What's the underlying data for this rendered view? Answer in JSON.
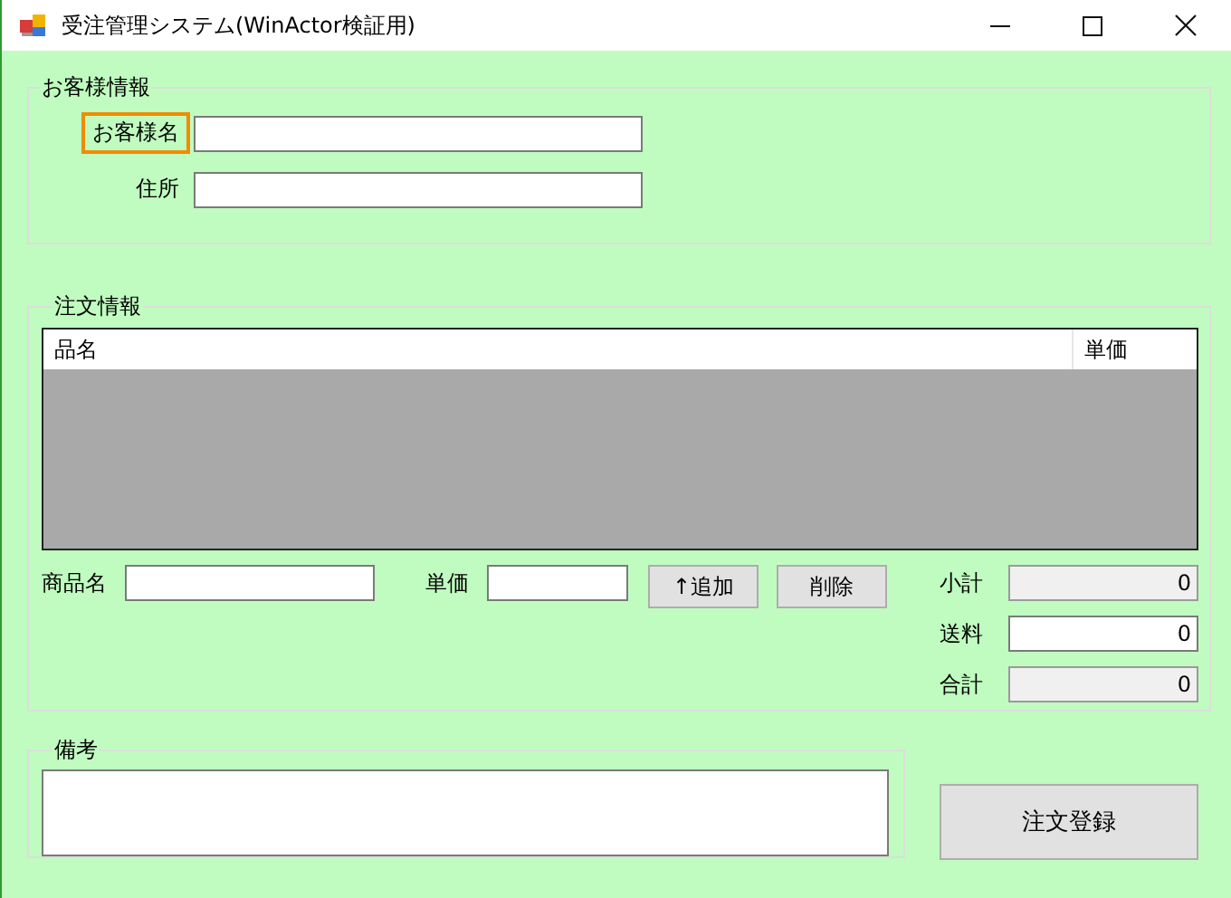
{
  "window": {
    "title": "受注管理システム(WinActor検証用)"
  },
  "customer_group": {
    "legend": "お客様情報",
    "fields": [
      {
        "label": "お客様名",
        "focused": true
      },
      {
        "label": "住所",
        "focused": false
      }
    ]
  },
  "order_group": {
    "legend": "注文情報",
    "list": {
      "columns": [
        "品名",
        "単価"
      ]
    },
    "entry": {
      "fields": [
        {
          "label": "商品名"
        },
        {
          "label": "単価"
        }
      ],
      "buttons": [
        "↑追加",
        "削除"
      ]
    },
    "totals": [
      {
        "label": "小計",
        "value": "0",
        "readonly": true
      },
      {
        "label": "送料",
        "value": "0",
        "readonly": false
      },
      {
        "label": "合計",
        "value": "0",
        "readonly": true
      }
    ]
  },
  "notes_group": {
    "legend": "備考"
  },
  "submit_button": "注文登録"
}
